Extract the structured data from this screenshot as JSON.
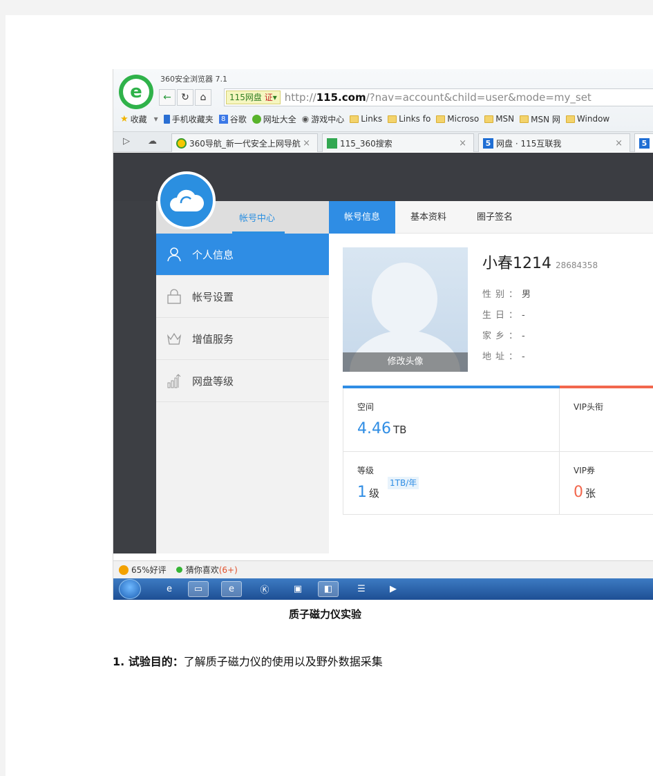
{
  "browser": {
    "app_title": "360安全浏览器 7.1",
    "address_badge": "115网盘",
    "address_badge_cert": "证",
    "address_url_prefix": "http://",
    "address_url_host": "115.com",
    "address_url_rest": "/?nav=account&child=user&mode=my_set",
    "bookmarks": [
      {
        "icon": "star-icon",
        "label": "收藏"
      },
      {
        "icon": "phone-icon",
        "label": "手机收藏夹"
      },
      {
        "icon": "google-icon",
        "label": "谷歌"
      },
      {
        "icon": "360-icon",
        "label": "网址大全"
      },
      {
        "icon": "game-icon",
        "label": "游戏中心"
      },
      {
        "icon": "folder-icon",
        "label": "Links"
      },
      {
        "icon": "folder-icon",
        "label": "Links fo"
      },
      {
        "icon": "folder-icon",
        "label": "Microso"
      },
      {
        "icon": "folder-icon",
        "label": "MSN"
      },
      {
        "icon": "folder-icon",
        "label": "MSN 网"
      },
      {
        "icon": "folder-icon",
        "label": "Window"
      }
    ],
    "tabs": [
      {
        "label": "360导航_新一代安全上网导航",
        "icon": "360-icon"
      },
      {
        "label": "115_360搜索",
        "icon": "search-icon"
      },
      {
        "label": "网盘 · 115互联我",
        "icon": "115-icon"
      }
    ]
  },
  "account": {
    "sidebar_title": "帐号中心",
    "sidebar_items": [
      {
        "label": "个人信息",
        "icon": "person-icon",
        "active": true
      },
      {
        "label": "帐号设置",
        "icon": "lock-icon",
        "active": false
      },
      {
        "label": "增值服务",
        "icon": "crown-icon",
        "active": false
      },
      {
        "label": "网盘等级",
        "icon": "bar-chart-icon",
        "active": false
      }
    ],
    "tabs": [
      {
        "label": "帐号信息",
        "active": true
      },
      {
        "label": "基本资料",
        "active": false
      },
      {
        "label": "圈子签名",
        "active": false
      }
    ],
    "photo_button": "修改头像",
    "username": "小春1214",
    "user_id": "28684358",
    "info": [
      {
        "label": "性别：",
        "value": "男"
      },
      {
        "label": "生日：",
        "value": "-"
      },
      {
        "label": "家乡：",
        "value": "-"
      },
      {
        "label": "地址：",
        "value": "-"
      }
    ],
    "stats": {
      "space_label": "空间",
      "space_value": "4.46",
      "space_unit": "TB",
      "vip_title_label": "VIP头衔",
      "level_label": "等级",
      "level_value": "1",
      "level_unit": "级",
      "level_tag": "1TB/年",
      "vip_coupon_label": "VIP券",
      "vip_coupon_value": "0",
      "vip_coupon_unit": "张"
    },
    "colors": {
      "accent": "#2f8de4",
      "red": "#f2674d"
    }
  },
  "status": {
    "rating": "65%好评",
    "guess": "猜你喜欢",
    "guess_count": "(6+)"
  },
  "document": {
    "caption": "质子磁力仪实验",
    "para_heading": "1. 试验目的：",
    "para_text": "了解质子磁力仪的使用以及野外数据采集"
  }
}
